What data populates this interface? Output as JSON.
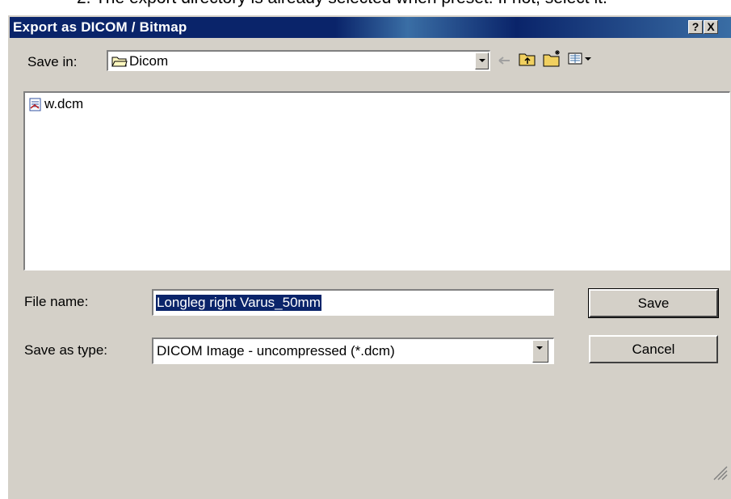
{
  "document": {
    "instruction_text": "2.    The export directory is already selected when preset. If not, select it."
  },
  "window": {
    "title": "Export as DICOM / Bitmap",
    "help_button": "?",
    "close_button": "X"
  },
  "toolbar": {
    "save_in_label": "Save in:",
    "save_in_value": "Dicom"
  },
  "file_list": {
    "items": [
      {
        "name": "w.dcm"
      }
    ]
  },
  "form": {
    "file_name_label": "File name:",
    "file_name_value": "Longleg right Varus_50mm",
    "save_as_type_label": "Save as type:",
    "save_as_type_value": "DICOM Image - uncompressed (*.dcm)"
  },
  "buttons": {
    "save": "Save",
    "cancel": "Cancel"
  }
}
